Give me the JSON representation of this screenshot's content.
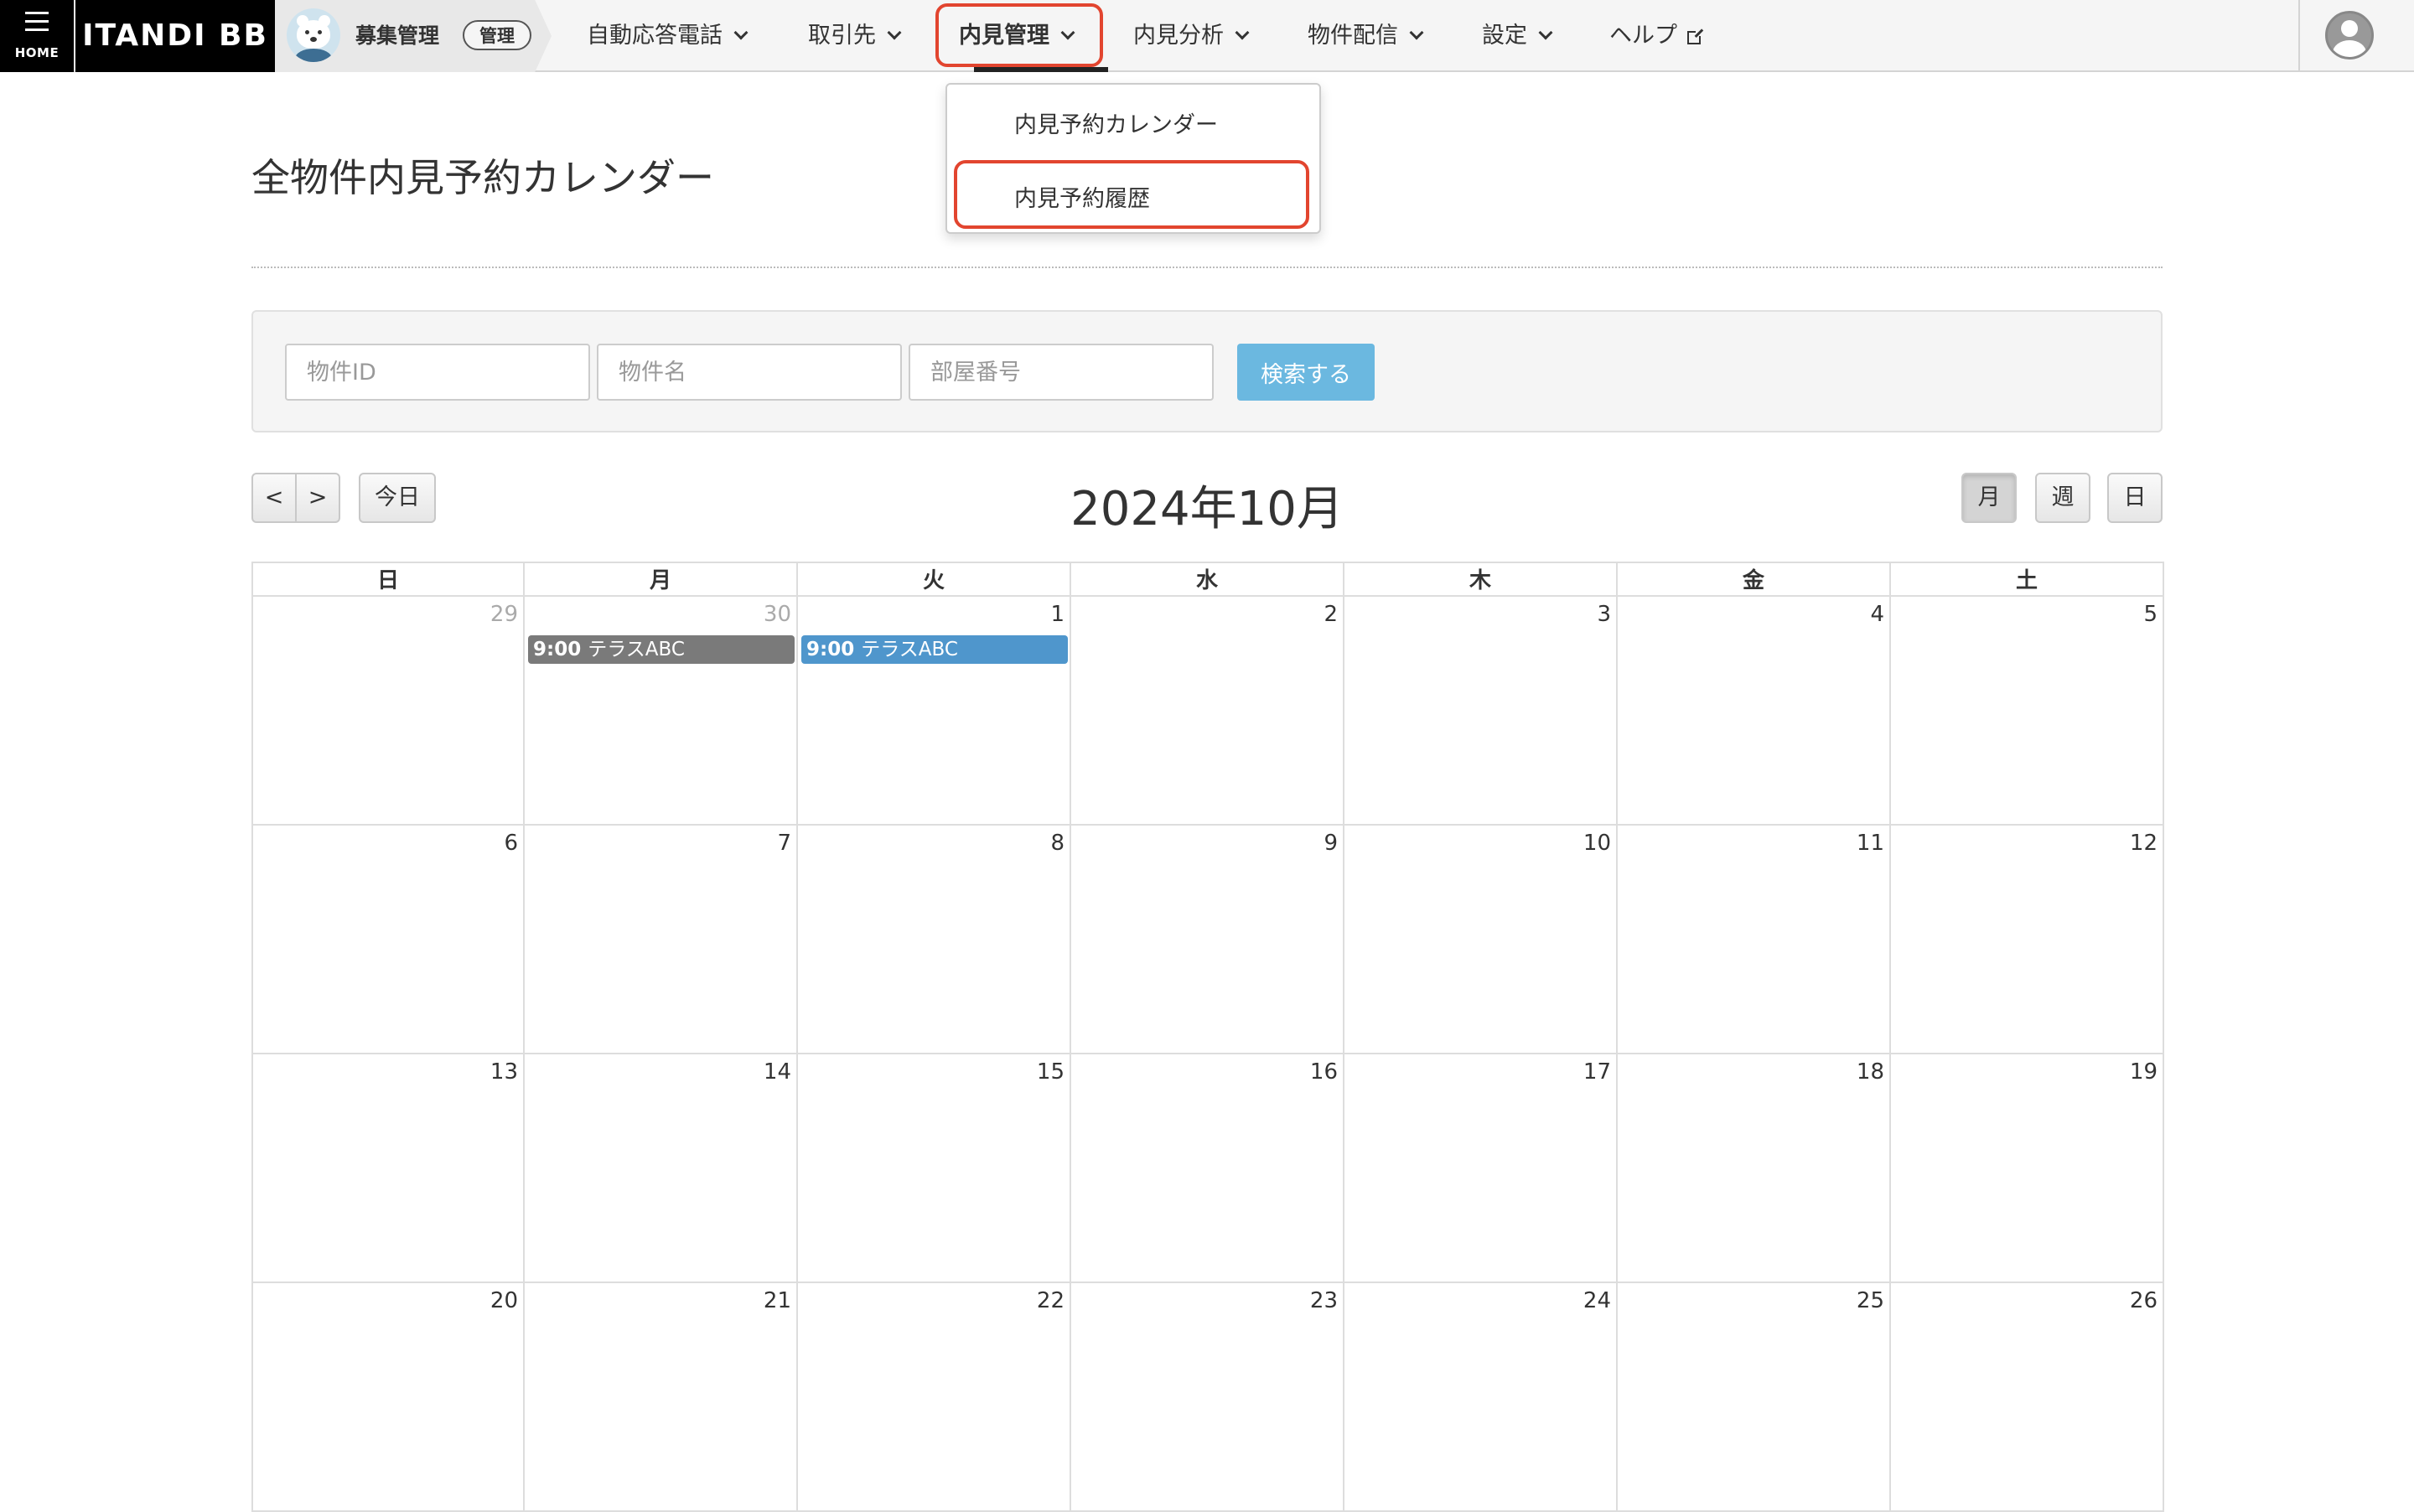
{
  "nav": {
    "home_label": "HOME",
    "brand": "ITANDI BB",
    "product_name": "募集管理",
    "product_badge": "管理",
    "items": [
      "自動応答電話",
      "取引先",
      "内見管理",
      "内見分析",
      "物件配信",
      "設定",
      "ヘルプ"
    ],
    "active_item": "内見管理"
  },
  "dropdown": {
    "items": [
      "内見予約カレンダー",
      "内見予約履歴"
    ],
    "highlighted": "内見予約履歴"
  },
  "page": {
    "title": "全物件内見予約カレンダー"
  },
  "search": {
    "property_id_placeholder": "物件ID",
    "property_name_placeholder": "物件名",
    "room_number_placeholder": "部屋番号",
    "submit_label": "検索する"
  },
  "calendar": {
    "prev_label": "<",
    "next_label": ">",
    "today_label": "今日",
    "month_title": "2024年10月",
    "views": [
      "月",
      "週",
      "日"
    ],
    "active_view": "月",
    "weekdays": [
      "日",
      "月",
      "火",
      "水",
      "木",
      "金",
      "土"
    ],
    "weeks": [
      [
        {
          "d": "29",
          "other": true
        },
        {
          "d": "30",
          "other": true
        },
        {
          "d": "1"
        },
        {
          "d": "2"
        },
        {
          "d": "3"
        },
        {
          "d": "4"
        },
        {
          "d": "5"
        }
      ],
      [
        {
          "d": "6"
        },
        {
          "d": "7"
        },
        {
          "d": "8"
        },
        {
          "d": "9"
        },
        {
          "d": "10"
        },
        {
          "d": "11"
        },
        {
          "d": "12"
        }
      ],
      [
        {
          "d": "13"
        },
        {
          "d": "14"
        },
        {
          "d": "15"
        },
        {
          "d": "16"
        },
        {
          "d": "17"
        },
        {
          "d": "18"
        },
        {
          "d": "19"
        }
      ],
      [
        {
          "d": "20"
        },
        {
          "d": "21"
        },
        {
          "d": "22"
        },
        {
          "d": "23"
        },
        {
          "d": "24"
        },
        {
          "d": "25"
        },
        {
          "d": "26"
        }
      ]
    ],
    "events": [
      {
        "day": "30",
        "time": "9:00",
        "title": "テラスABC",
        "color": "#7a7a7a"
      },
      {
        "day": "1",
        "time": "9:00",
        "title": "テラスABC",
        "color": "#4f96cc"
      }
    ]
  },
  "colors": {
    "highlight": "#e2452f",
    "search_button": "#6bb8e0"
  }
}
